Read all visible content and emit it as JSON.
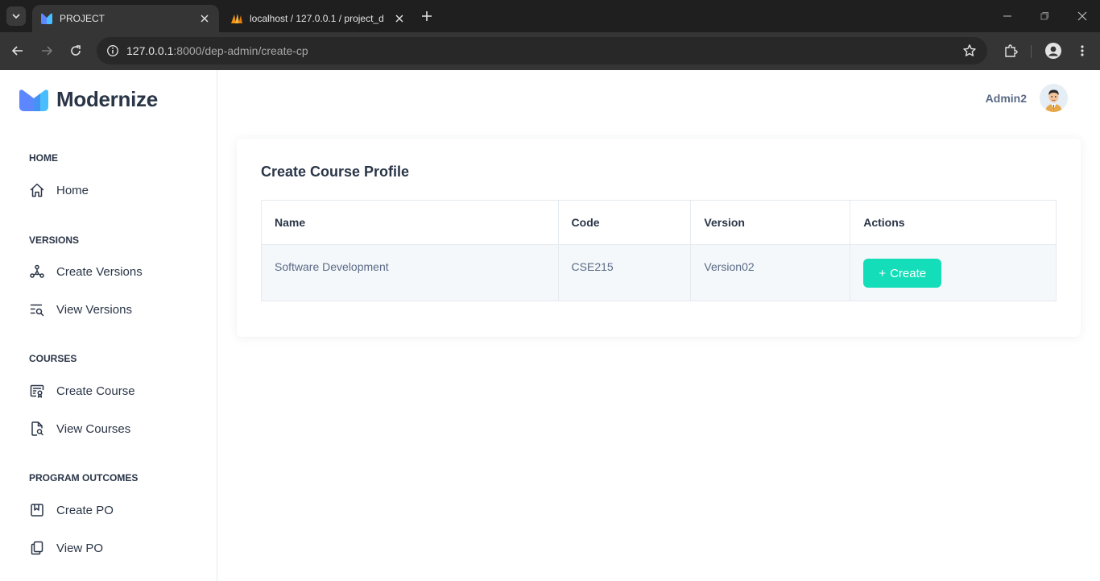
{
  "browser": {
    "tabs": [
      {
        "title": "PROJECT",
        "active": true
      },
      {
        "title": "localhost / 127.0.0.1 / project_d",
        "active": false
      }
    ],
    "url": {
      "host": "127.0.0.1",
      "rest": ":8000/dep-admin/create-cp"
    }
  },
  "brand": {
    "name": "Modernize"
  },
  "sidebar": {
    "sections": [
      {
        "title": "HOME",
        "items": [
          {
            "label": "Home",
            "icon": "home-icon"
          }
        ]
      },
      {
        "title": "VERSIONS",
        "items": [
          {
            "label": "Create Versions",
            "icon": "versions-icon"
          },
          {
            "label": "View Versions",
            "icon": "list-search-icon"
          }
        ]
      },
      {
        "title": "COURSES",
        "items": [
          {
            "label": "Create Course",
            "icon": "certificate-icon"
          },
          {
            "label": "View Courses",
            "icon": "file-search-icon"
          }
        ]
      },
      {
        "title": "PROGRAM OUTCOMES",
        "items": [
          {
            "label": "Create PO",
            "icon": "bookmark-icon"
          },
          {
            "label": "View PO",
            "icon": "copy-icon"
          }
        ]
      }
    ]
  },
  "header": {
    "user_name": "Admin2"
  },
  "card": {
    "title": "Create Course Profile",
    "columns": [
      "Name",
      "Code",
      "Version",
      "Actions"
    ],
    "rows": [
      {
        "name": "Software Development",
        "code": "CSE215",
        "version": "Version02",
        "action": "Create"
      }
    ]
  },
  "colors": {
    "accent": "#13deb9",
    "brand_blue": "#5d87ff",
    "text_dark": "#2a3547",
    "text_muted": "#5a6a85"
  }
}
